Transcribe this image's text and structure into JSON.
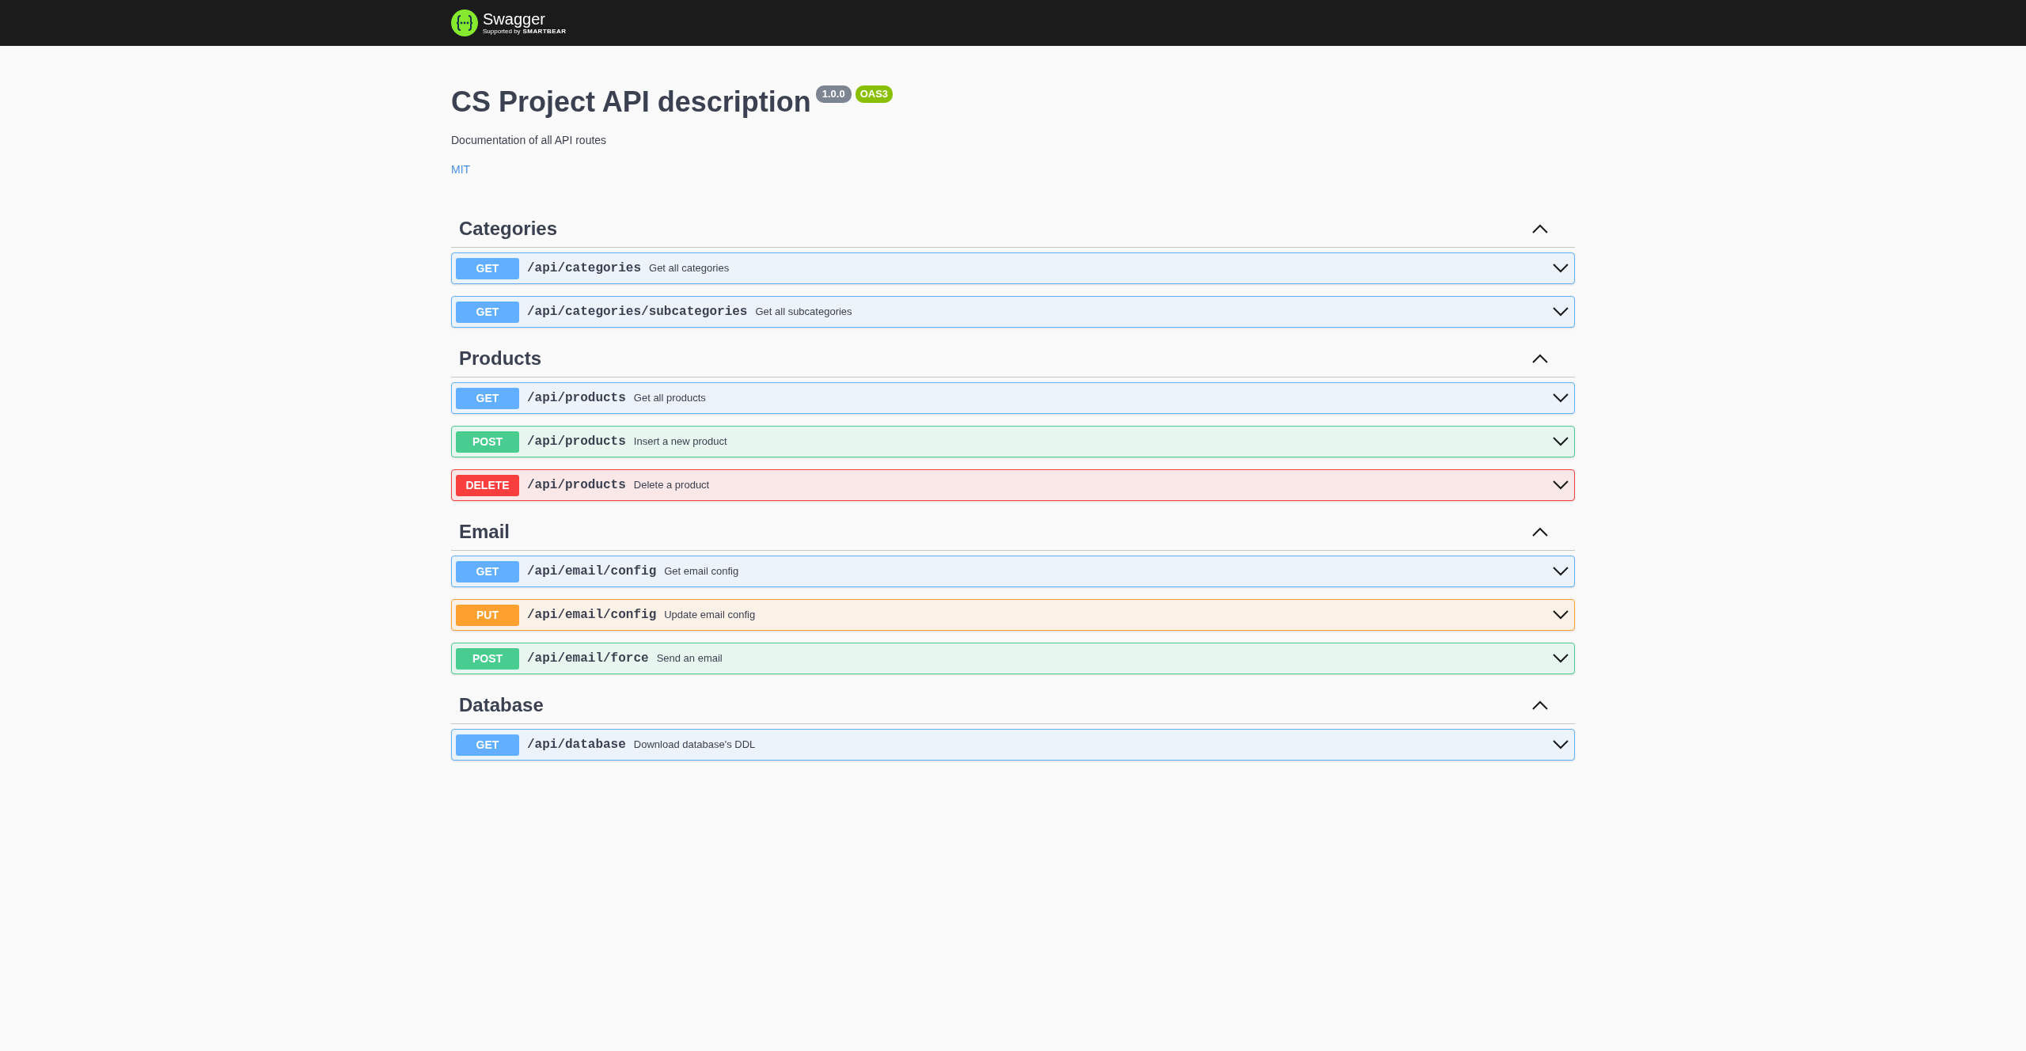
{
  "topbar": {
    "logo_text": "Swagger",
    "logo_sub": "Supported by",
    "logo_brand": "SMARTBEAR"
  },
  "info": {
    "title": "CS Project API description",
    "version": "1.0.0",
    "spec": "OAS3",
    "description": "Documentation of all API routes",
    "license": "MIT"
  },
  "sections": [
    {
      "name": "Categories",
      "expanded": true,
      "operations": [
        {
          "kind": "get",
          "method": "GET",
          "path": "/api/categories",
          "summary": "Get all categories",
          "expanded": false
        },
        {
          "kind": "get",
          "method": "GET",
          "path": "/api/categories/subcategories",
          "summary": "Get all subcategories",
          "expanded": false
        }
      ]
    },
    {
      "name": "Products",
      "expanded": true,
      "operations": [
        {
          "kind": "get",
          "method": "GET",
          "path": "/api/products",
          "summary": "Get all products",
          "expanded": false
        },
        {
          "kind": "post",
          "method": "POST",
          "path": "/api/products",
          "summary": "Insert a new product",
          "expanded": false
        },
        {
          "kind": "delete",
          "method": "DELETE",
          "path": "/api/products",
          "summary": "Delete a product",
          "expanded": false
        }
      ]
    },
    {
      "name": "Email",
      "expanded": true,
      "operations": [
        {
          "kind": "get",
          "method": "GET",
          "path": "/api/email/config",
          "summary": "Get email config",
          "expanded": false
        },
        {
          "kind": "put",
          "method": "PUT",
          "path": "/api/email/config",
          "summary": "Update email config",
          "expanded": false
        },
        {
          "kind": "post",
          "method": "POST",
          "path": "/api/email/force",
          "summary": "Send an email",
          "expanded": false
        }
      ]
    },
    {
      "name": "Database",
      "expanded": true,
      "operations": [
        {
          "kind": "get",
          "method": "GET",
          "path": "/api/database",
          "summary": "Download database's DDL",
          "expanded": false
        }
      ]
    }
  ]
}
